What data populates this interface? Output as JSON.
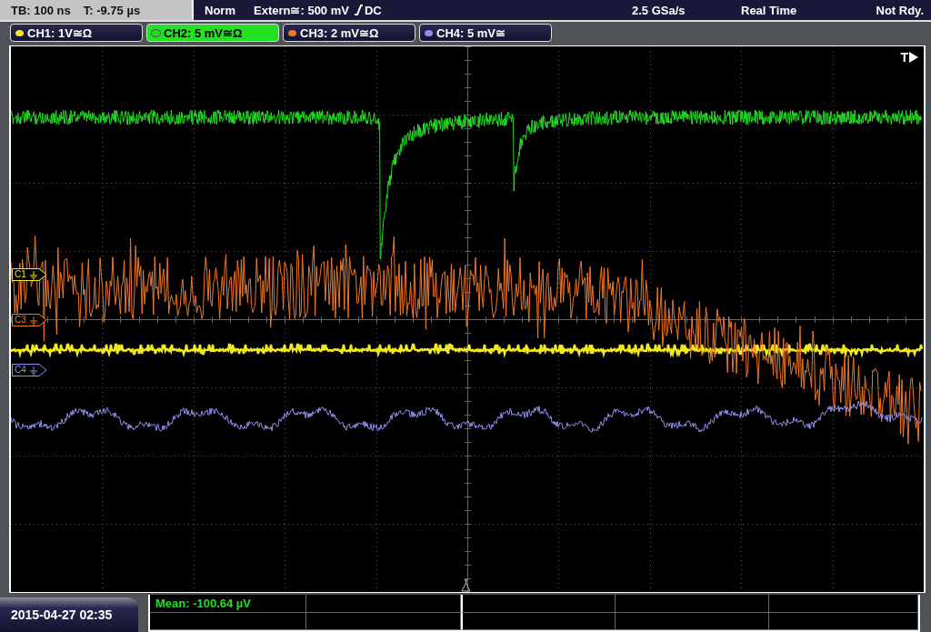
{
  "status_bar": {
    "timebase": "TB: 100 ns",
    "trigger_time": "T: -9.75 µs",
    "mode": "Norm",
    "trigger_source": "Extern≅: 500 mV",
    "coupling": "DC",
    "sample_rate": "2.5 GSa/s",
    "acquisition": "Real Time",
    "state": "Not Rdy."
  },
  "channels": [
    {
      "label": "CH1: 1V≅Ω",
      "color": "#f2e81e",
      "selected": false
    },
    {
      "label": "CH2: 5 mV≅Ω",
      "color": "#22dd22",
      "selected": true
    },
    {
      "label": "CH3: 2 mV≅Ω",
      "color": "#f07828",
      "selected": false
    },
    {
      "label": "CH4: 5 mV≅",
      "color": "#9090ee",
      "selected": false
    }
  ],
  "trigger_label": "T",
  "markers": [
    {
      "label": "C1",
      "color": "#f2e81e"
    },
    {
      "label": "C3",
      "color": "#f07828"
    },
    {
      "label": "C4",
      "color": "#9090ee"
    }
  ],
  "measurement": "Mean: -100.64 µV",
  "date": "2015-04-27 02:35"
}
